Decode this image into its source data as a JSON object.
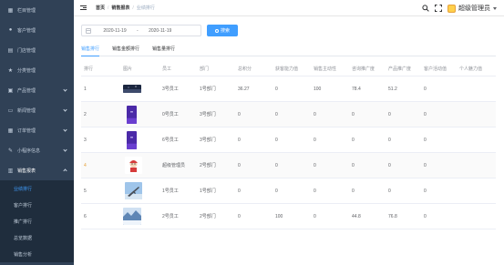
{
  "sidebar": {
    "items": [
      {
        "label": "栏目管理",
        "icon": "grid-icon",
        "glyph": "▦"
      },
      {
        "label": "客户管理",
        "icon": "user-icon",
        "glyph": "👤"
      },
      {
        "label": "门店管理",
        "icon": "store-icon",
        "glyph": "▤"
      },
      {
        "label": "分类管理",
        "icon": "star-icon",
        "glyph": "★"
      },
      {
        "label": "产品管理",
        "icon": "box-icon",
        "glyph": "▣"
      },
      {
        "label": "新闻管理",
        "icon": "news-icon",
        "glyph": "▭"
      },
      {
        "label": "订单管理",
        "icon": "order-icon",
        "glyph": "▦"
      },
      {
        "label": "小程序信息",
        "icon": "chat-icon",
        "glyph": "✎"
      },
      {
        "label": "销售报表",
        "icon": "chart-icon",
        "glyph": "▥"
      }
    ],
    "submenu": [
      "业绩排行",
      "客户排行",
      "推广排行",
      "总览数据",
      "销售分析"
    ]
  },
  "header": {
    "breadcrumb": [
      "首页",
      "销售报表",
      "业绩排行"
    ],
    "username": "超级管理员"
  },
  "toolbar": {
    "date_start": "2020-11-19",
    "date_sep": "-",
    "date_end": "2020-11-19",
    "search_label": "搜索"
  },
  "tabs": [
    "销售排行",
    "销售金额排行",
    "销售量排行"
  ],
  "table": {
    "columns": [
      "排行",
      "图片",
      "员工",
      "部门",
      "总积分",
      "获客能力值",
      "销售主动性",
      "咨询推广度",
      "产品推广度",
      "客户活动值",
      "个人魅力值"
    ],
    "rows": [
      {
        "rank": "1",
        "image": "night-sky",
        "name": "3号员工",
        "dept": "1号部门",
        "score": "36.27",
        "v1": "0",
        "v2": "100",
        "v3": "78.4",
        "v4": "51.2",
        "v5": "0",
        "v6": ""
      },
      {
        "rank": "2",
        "image": "purple-phone",
        "name": "0号员工",
        "dept": "3号部门",
        "score": "0",
        "v1": "0",
        "v2": "0",
        "v3": "0",
        "v4": "0",
        "v5": "0",
        "v6": ""
      },
      {
        "rank": "3",
        "image": "purple-phone",
        "name": "6号员工",
        "dept": "3号部门",
        "score": "0",
        "v1": "0",
        "v2": "0",
        "v3": "0",
        "v4": "0",
        "v5": "0",
        "v6": ""
      },
      {
        "rank": "4",
        "image": "cartoon",
        "name": "超级管理员",
        "dept": "2号部门",
        "score": "0",
        "v1": "0",
        "v2": "0",
        "v3": "0",
        "v4": "0",
        "v5": "0",
        "v6": ""
      },
      {
        "rank": "5",
        "image": "plane",
        "name": "1号员工",
        "dept": "1号部门",
        "score": "0",
        "v1": "0",
        "v2": "0",
        "v3": "0",
        "v4": "0",
        "v5": "0",
        "v6": ""
      },
      {
        "rank": "6",
        "image": "snow",
        "name": "2号员工",
        "dept": "2号部门",
        "score": "0",
        "v1": "100",
        "v2": "0",
        "v3": "44.8",
        "v4": "76.8",
        "v5": "0",
        "v6": ""
      }
    ]
  },
  "colors": {
    "sidebar_bg": "#304156",
    "submenu_bg": "#1f2d3d",
    "accent": "#409eff"
  }
}
